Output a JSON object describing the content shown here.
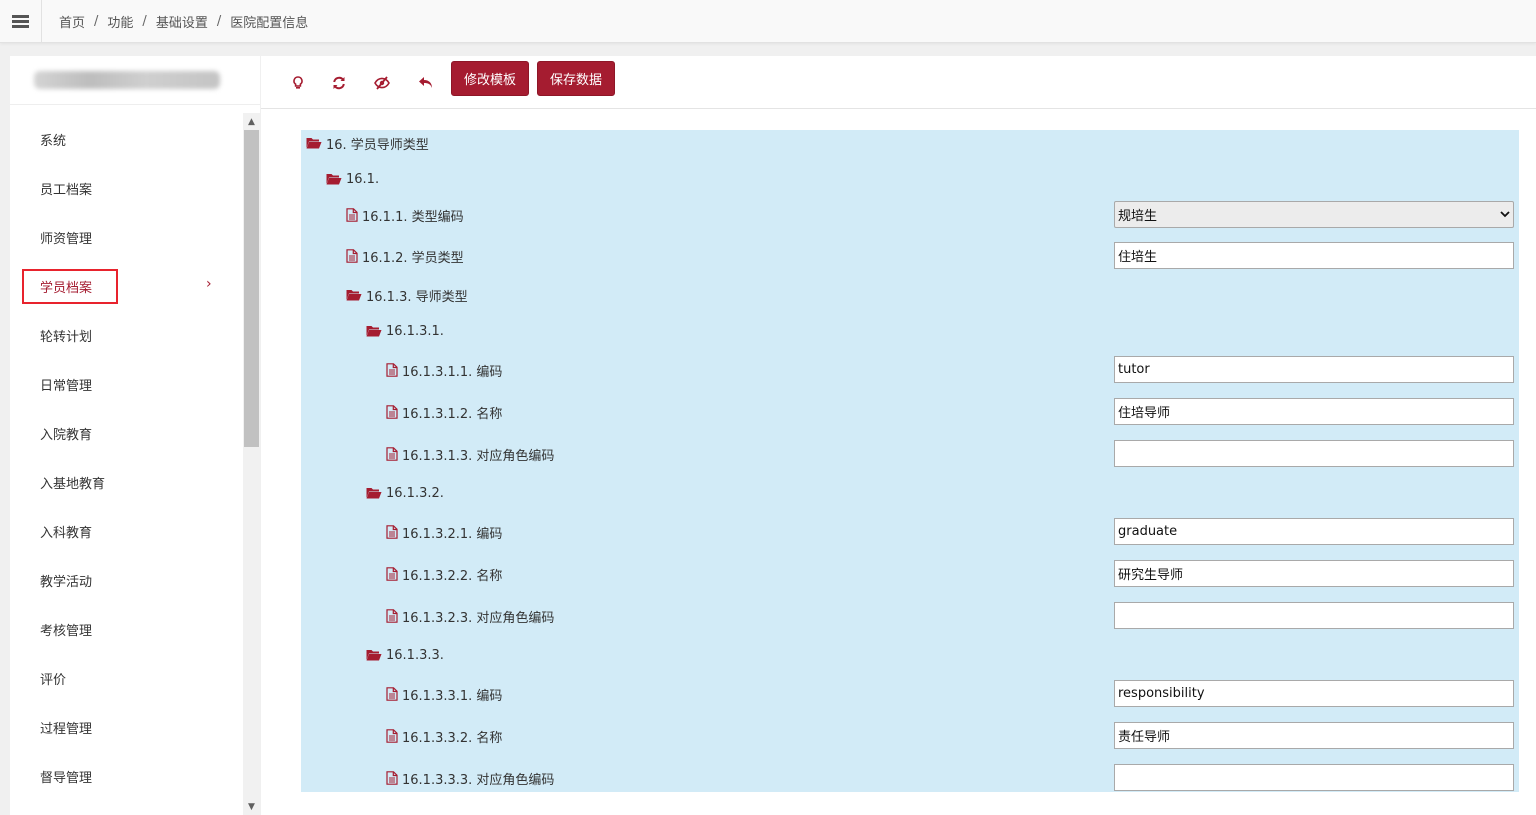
{
  "breadcrumb": [
    "首页",
    "功能",
    "基础设置",
    "医院配置信息"
  ],
  "sidebar": {
    "items": [
      {
        "label": "系统"
      },
      {
        "label": "员工档案"
      },
      {
        "label": "师资管理"
      },
      {
        "label": "学员档案",
        "active": true
      },
      {
        "label": "轮转计划"
      },
      {
        "label": "日常管理"
      },
      {
        "label": "入院教育"
      },
      {
        "label": "入基地教育"
      },
      {
        "label": "入科教育"
      },
      {
        "label": "教学活动"
      },
      {
        "label": "考核管理"
      },
      {
        "label": "评价"
      },
      {
        "label": "过程管理"
      },
      {
        "label": "督导管理"
      }
    ]
  },
  "toolbar": {
    "icons": [
      "lightbulb-icon",
      "refresh-icon",
      "eye-slash-icon",
      "undo-icon"
    ],
    "edit_template_label": "修改模板",
    "save_data_label": "保存数据"
  },
  "tree": {
    "rows": [
      {
        "label": "16. 学员导师类型",
        "icon": "folder-open-icon"
      },
      {
        "label": "16.1.",
        "icon": "folder-open-icon"
      },
      {
        "label": "16.1.1. 类型编码",
        "icon": "file-icon",
        "control": "select",
        "value": "规培生"
      },
      {
        "label": "16.1.2. 学员类型",
        "icon": "file-icon",
        "control": "input",
        "value": "住培生"
      },
      {
        "label": "16.1.3. 导师类型",
        "icon": "folder-open-icon"
      },
      {
        "label": "16.1.3.1.",
        "icon": "folder-open-icon"
      },
      {
        "label": "16.1.3.1.1. 编码",
        "icon": "file-icon",
        "control": "input",
        "value": "tutor"
      },
      {
        "label": "16.1.3.1.2. 名称",
        "icon": "file-icon",
        "control": "input",
        "value": "住培导师"
      },
      {
        "label": "16.1.3.1.3. 对应角色编码",
        "icon": "file-icon",
        "control": "input",
        "value": ""
      },
      {
        "label": "16.1.3.2.",
        "icon": "folder-open-icon"
      },
      {
        "label": "16.1.3.2.1. 编码",
        "icon": "file-icon",
        "control": "input",
        "value": "graduate"
      },
      {
        "label": "16.1.3.2.2. 名称",
        "icon": "file-icon",
        "control": "input",
        "value": "研究生导师"
      },
      {
        "label": "16.1.3.2.3. 对应角色编码",
        "icon": "file-icon",
        "control": "input",
        "value": ""
      },
      {
        "label": "16.1.3.3.",
        "icon": "folder-open-icon"
      },
      {
        "label": "16.1.3.3.1. 编码",
        "icon": "file-icon",
        "control": "input",
        "value": "responsibility"
      },
      {
        "label": "16.1.3.3.2. 名称",
        "icon": "file-icon",
        "control": "input",
        "value": "责任导师"
      },
      {
        "label": "16.1.3.3.3. 对应角色编码",
        "icon": "file-icon",
        "control": "input",
        "value": ""
      }
    ]
  },
  "colors": {
    "accent": "#a51c30",
    "tree_bg": "#d2ebf7",
    "highlight_border": "#e8232d"
  }
}
